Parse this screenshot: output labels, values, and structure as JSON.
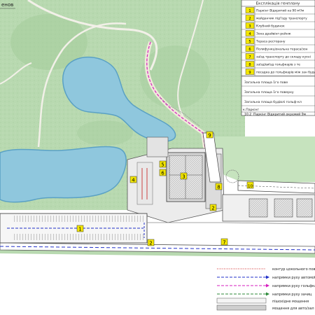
{
  "explication": {
    "title": "Експлікація генплану",
    "items": [
      {
        "num": "1",
        "label": "Паркінг Відкритий на 90 м²/м"
      },
      {
        "num": "2",
        "label": "майданчик під'їзду транспорту"
      },
      {
        "num": "3",
        "label": "Клубний будинок"
      },
      {
        "num": "4",
        "label": "Зона драйвінг-рейнж"
      },
      {
        "num": "5",
        "label": "Тераса ресторану"
      },
      {
        "num": "6",
        "label": "Полифункціональна тераса/зон"
      },
      {
        "num": "7",
        "label": "заїзд транспорту до складу кухні"
      },
      {
        "num": "8",
        "label": "заїзд/виїзд гольфкарів з те"
      },
      {
        "num": "9",
        "label": "посадка до гольфкарів між зан будинком варон"
      }
    ],
    "summary_rows": [
      "Загальна площа 1го пове",
      "Загальна площа 1го поверху",
      "Загальна площа будівлі гольф-кл"
    ],
    "parking_heading": "к.Паркінг",
    "parking_rows": [
      {
        "code": "10.2",
        "label": "Паркінг Відкритий окремий 9м"
      }
    ]
  },
  "legend": {
    "items": [
      {
        "label": "контур цокольного пове",
        "style": "dotted-red"
      },
      {
        "label": "напрямки руху автомоб",
        "style": "dashed-blue"
      },
      {
        "label": "напрямки руху гольфкар",
        "style": "dashed-magenta"
      },
      {
        "label": "напрямки руху зачиц",
        "style": "dashed-green"
      },
      {
        "label": "пішохідне мощення",
        "style": "swatch-light"
      },
      {
        "label": "мощення для авто/зал",
        "style": "swatch-gray"
      }
    ]
  },
  "map": {
    "corner_label": "енов",
    "markers": [
      {
        "num": "1"
      },
      {
        "num": "2"
      },
      {
        "num": "3"
      },
      {
        "num": "4"
      },
      {
        "num": "5"
      },
      {
        "num": "6"
      },
      {
        "num": "7"
      },
      {
        "num": "8"
      },
      {
        "num": "9"
      },
      {
        "num": "10"
      },
      {
        "num": "2"
      }
    ]
  },
  "colors": {
    "grass": "#b8d9b0",
    "grass_dark": "#a2cb9a",
    "water": "#8fc7dd",
    "water_edge": "#5aa1c4",
    "road": "#ece6d8",
    "marker": "#f3e600",
    "building": "#d8d8d8"
  }
}
